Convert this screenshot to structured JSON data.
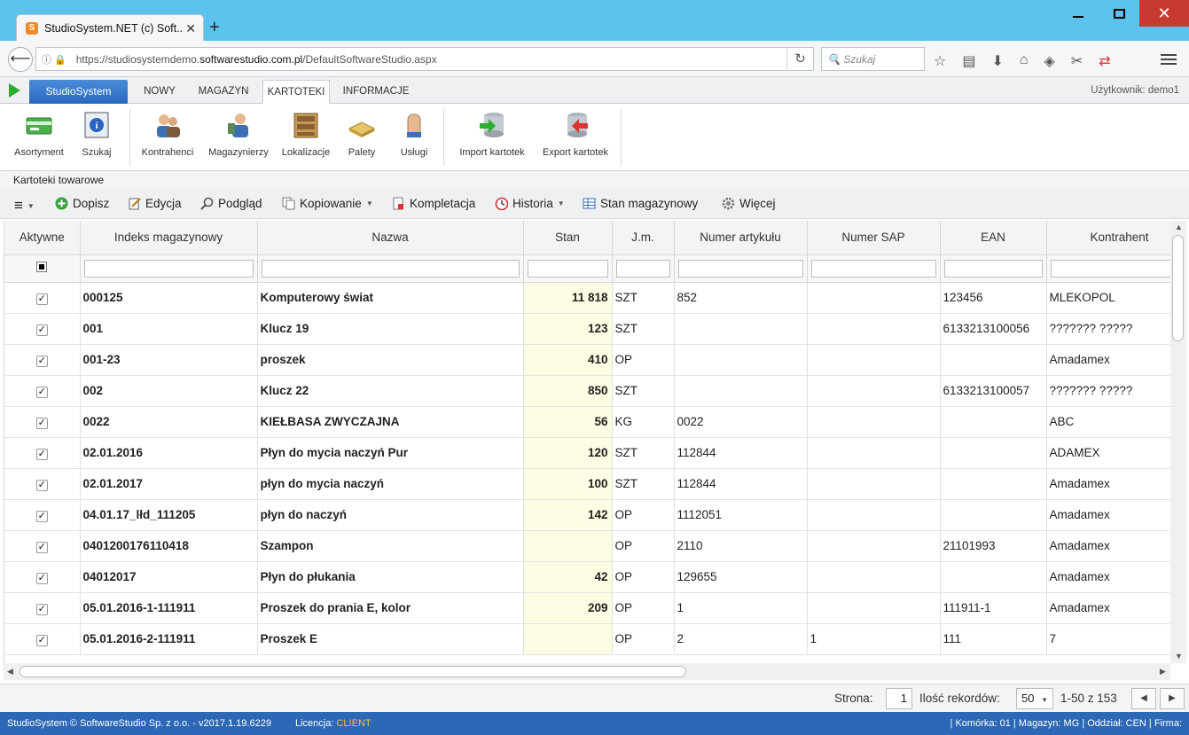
{
  "browser": {
    "tab_title": "StudioSystem.NET (c) Soft...",
    "tab_favicon": "S",
    "new_tab": "+",
    "url_prefix": "https://studiosystemdemo.",
    "url_domain": "softwarestudio.com.pl",
    "url_path": "/DefaultSoftwareStudio.aspx",
    "search_placeholder": "Szukaj"
  },
  "app": {
    "brand": "StudioSystem",
    "tabs": [
      "NOWY",
      "MAGAZYN",
      "KARTOTEKI",
      "INFORMACJE"
    ],
    "active_tab": "KARTOTEKI",
    "user": "Użytkownik: demo1"
  },
  "ribbon": {
    "buttons": [
      "Asortyment",
      "Szukaj",
      "Kontrahenci",
      "Magazynierzy",
      "Lokalizacje",
      "Palety",
      "Usługi",
      "Import kartotek",
      "Export kartotek"
    ]
  },
  "section_title": "Kartoteki towarowe",
  "actions": {
    "dopisz": "Dopisz",
    "edycja": "Edycja",
    "podglad": "Podgląd",
    "kopiowanie": "Kopiowanie",
    "kompletacja": "Kompletacja",
    "historia": "Historia",
    "stan": "Stan magazynowy",
    "wiecej": "Więcej"
  },
  "grid": {
    "columns": [
      "Aktywne",
      "Indeks magazynowy",
      "Nazwa",
      "Stan",
      "J.m.",
      "Numer artykułu",
      "Numer SAP",
      "EAN",
      "Kontrahent"
    ],
    "rows": [
      {
        "active": true,
        "indeks": "000125",
        "nazwa": "Komputerowy świat",
        "stan": "11 818",
        "jm": "SZT",
        "nr_art": "852",
        "sap": "",
        "ean": "123456",
        "kontrahent": "MLEKOPOL"
      },
      {
        "active": true,
        "indeks": "001",
        "nazwa": "Klucz 19",
        "stan": "123",
        "jm": "SZT",
        "nr_art": "",
        "sap": "",
        "ean": "6133213100056",
        "kontrahent": "??????? ?????"
      },
      {
        "active": true,
        "indeks": "001-23",
        "nazwa": "proszek",
        "stan": "410",
        "jm": "OP",
        "nr_art": "",
        "sap": "",
        "ean": "",
        "kontrahent": "Amadamex"
      },
      {
        "active": true,
        "indeks": "002",
        "nazwa": "Klucz 22",
        "stan": "850",
        "jm": "SZT",
        "nr_art": "",
        "sap": "",
        "ean": "6133213100057",
        "kontrahent": "??????? ?????"
      },
      {
        "active": true,
        "indeks": "0022",
        "nazwa": "KIEŁBASA ZWYCZAJNA",
        "stan": "56",
        "jm": "KG",
        "nr_art": "0022",
        "sap": "",
        "ean": "",
        "kontrahent": "ABC"
      },
      {
        "active": true,
        "indeks": "02.01.2016",
        "nazwa": "Płyn do mycia naczyń Pur",
        "stan": "120",
        "jm": "SZT",
        "nr_art": "112844",
        "sap": "",
        "ean": "",
        "kontrahent": "ADAMEX"
      },
      {
        "active": true,
        "indeks": "02.01.2017",
        "nazwa": "płyn do mycia naczyń",
        "stan": "100",
        "jm": "SZT",
        "nr_art": "112844",
        "sap": "",
        "ean": "",
        "kontrahent": "Amadamex"
      },
      {
        "active": true,
        "indeks": "04.01.17_lłd_111205",
        "nazwa": "płyn do naczyń",
        "stan": "142",
        "jm": "OP",
        "nr_art": "1112051",
        "sap": "",
        "ean": "",
        "kontrahent": "Amadamex"
      },
      {
        "active": true,
        "indeks": "0401200176110418",
        "nazwa": "Szampon",
        "stan": "",
        "jm": "OP",
        "nr_art": "2110",
        "sap": "",
        "ean": "21101993",
        "kontrahent": "Amadamex"
      },
      {
        "active": true,
        "indeks": "04012017",
        "nazwa": "Płyn do płukania",
        "stan": "42",
        "jm": "OP",
        "nr_art": "129655",
        "sap": "",
        "ean": "",
        "kontrahent": "Amadamex"
      },
      {
        "active": true,
        "indeks": "05.01.2016-1-111911",
        "nazwa": "Proszek do prania E, kolor",
        "stan": "209",
        "jm": "OP",
        "nr_art": "1",
        "sap": "",
        "ean": "111911-1",
        "kontrahent": "Amadamex"
      },
      {
        "active": true,
        "indeks": "05.01.2016-2-111911",
        "nazwa": "Proszek E",
        "stan": "",
        "jm": "OP",
        "nr_art": "2",
        "sap": "1",
        "ean": "111",
        "kontrahent": "7"
      }
    ]
  },
  "pager": {
    "page_label": "Strona:",
    "page": "1",
    "records_label": "Ilość rekordów:",
    "records": "50",
    "range": "1-50 z 153"
  },
  "status": {
    "left": "StudioSystem © SoftwareStudio Sp. z o.o. - v2017.1.19.6229",
    "license_label": "Licencja:",
    "license": "CLIENT",
    "right": "| Komórka: 01 | Magazyn: MG | Oddział: CEN | Firma:"
  }
}
